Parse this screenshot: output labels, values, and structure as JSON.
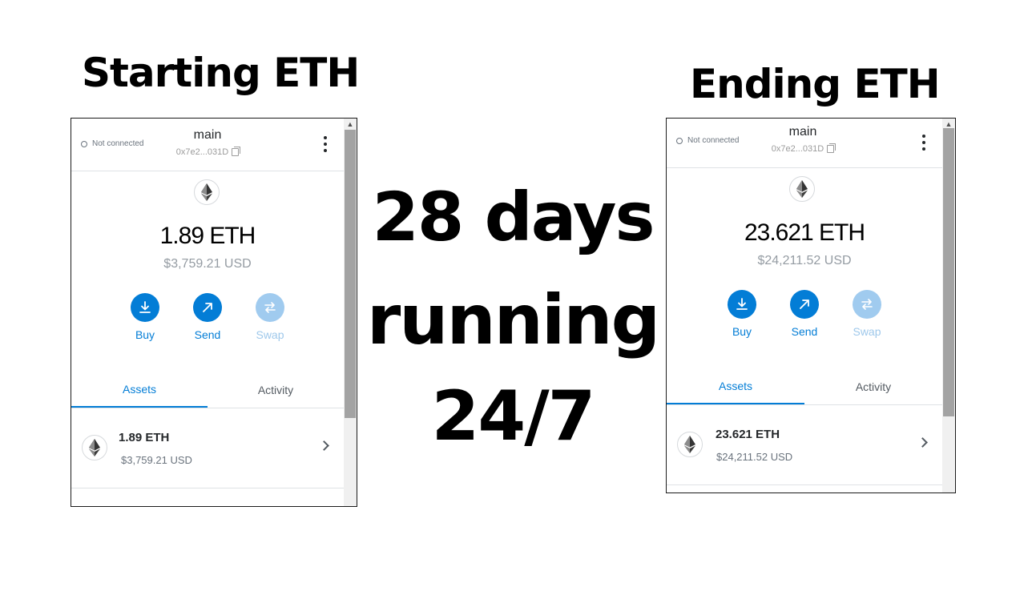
{
  "headings": {
    "left": "Starting ETH",
    "right": "Ending ETH"
  },
  "center_text": {
    "line1": "28 days",
    "line2": "running",
    "line3": "24/7"
  },
  "wallets": {
    "left": {
      "connection_status": "Not connected",
      "account_name": "main",
      "account_address": "0x7e2...031D",
      "balance": "1.89 ETH",
      "fiat_balance": "$3,759.21 USD",
      "actions": {
        "buy": "Buy",
        "send": "Send",
        "swap": "Swap"
      },
      "tabs": {
        "assets": "Assets",
        "activity": "Activity"
      },
      "asset": {
        "amount": "1.89 ETH",
        "fiat": "$3,759.21 USD"
      }
    },
    "right": {
      "connection_status": "Not connected",
      "account_name": "main",
      "account_address": "0x7e2...031D",
      "balance": "23.621 ETH",
      "fiat_balance": "$24,211.52 USD",
      "actions": {
        "buy": "Buy",
        "send": "Send",
        "swap": "Swap"
      },
      "tabs": {
        "assets": "Assets",
        "activity": "Activity"
      },
      "asset": {
        "amount": "23.621 ETH",
        "fiat": "$24,211.52 USD"
      }
    }
  },
  "colors": {
    "accent": "#037dd6",
    "accent_disabled": "#a0cbef",
    "text_primary": "#24272a",
    "text_muted": "#959ca3"
  },
  "icons": {
    "token": "ethereum-icon",
    "buy": "download-icon",
    "send": "arrow-up-right-icon",
    "swap": "swap-arrows-icon",
    "menu": "kebab-menu-icon",
    "copy": "copy-icon",
    "row": "chevron-right-icon"
  }
}
